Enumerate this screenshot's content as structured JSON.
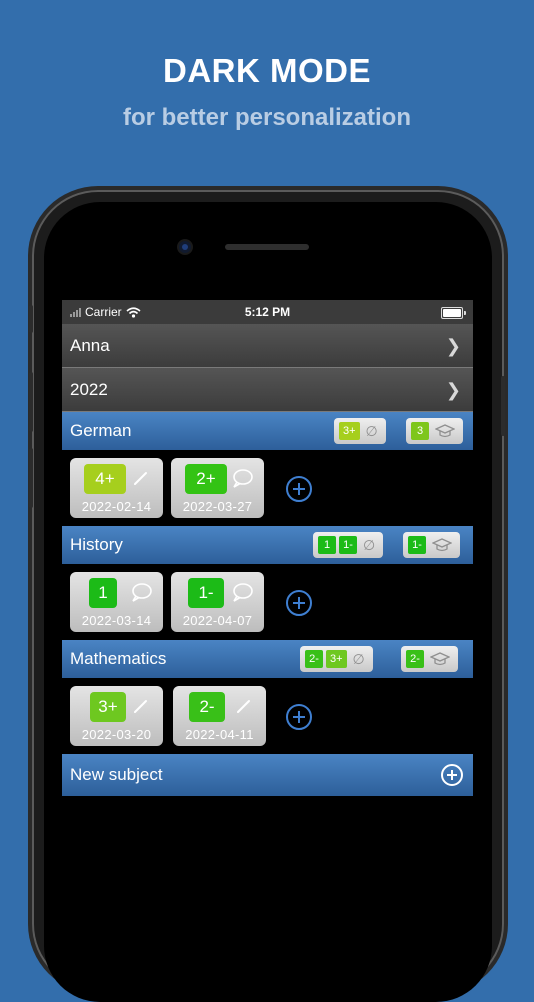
{
  "promo": {
    "headline": "DARK MODE",
    "subline": "for better personalization"
  },
  "status_bar": {
    "carrier": "Carrier",
    "time": "5:12 PM"
  },
  "student": {
    "name": "Anna"
  },
  "year": {
    "label": "2022"
  },
  "subjects": [
    {
      "name": "German",
      "oral_summary": [
        "3+"
      ],
      "exam_summary": [
        "3"
      ],
      "grades": [
        {
          "value": "4+",
          "date": "2022-02-14",
          "icon": "pencil-icon",
          "color": "#a6cf1d"
        },
        {
          "value": "2+",
          "date": "2022-03-27",
          "icon": "speech-bubble-icon",
          "color": "#33c314"
        }
      ]
    },
    {
      "name": "History",
      "oral_summary": [
        "1",
        "1-"
      ],
      "exam_summary": [
        "1-"
      ],
      "grades": [
        {
          "value": "1",
          "date": "2022-03-14",
          "icon": "speech-bubble-icon",
          "color": "#1cbb17"
        },
        {
          "value": "1-",
          "date": "2022-04-07",
          "icon": "speech-bubble-icon",
          "color": "#1cbb17"
        }
      ]
    },
    {
      "name": "Mathematics",
      "oral_summary": [
        "2-",
        "3+"
      ],
      "exam_summary": [
        "2-"
      ],
      "grades": [
        {
          "value": "3+",
          "date": "2022-03-20",
          "icon": "pencil-icon",
          "color": "#6ec820"
        },
        {
          "value": "2-",
          "date": "2022-04-11",
          "icon": "pencil-icon",
          "color": "#39c018"
        }
      ]
    }
  ],
  "new_subject": {
    "label": "New subject"
  },
  "colors": {
    "background": "#336eac",
    "header_blue": "#3a72b2",
    "add_blue": "#3f7fd1"
  }
}
